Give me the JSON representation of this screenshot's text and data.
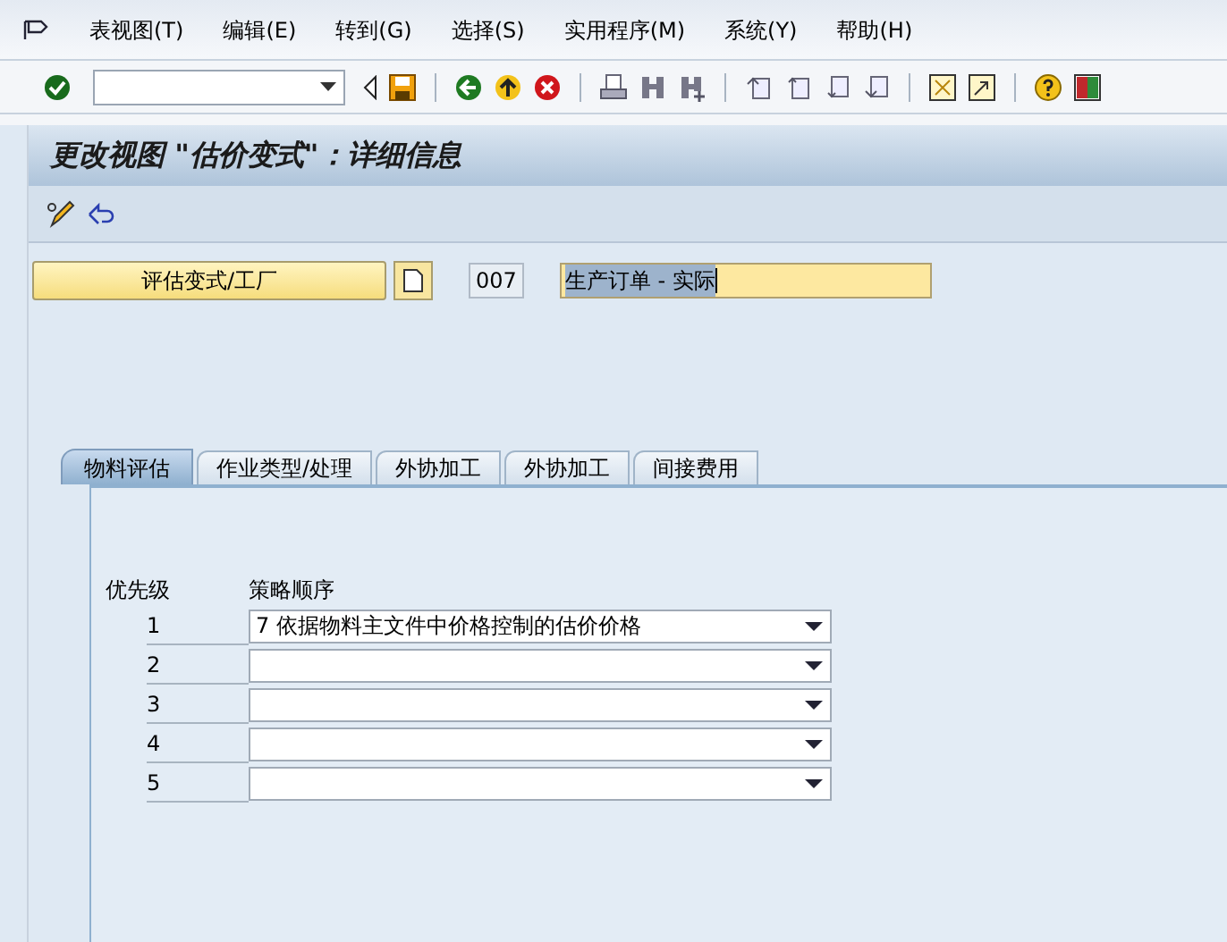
{
  "menu": [
    "表视图(T)",
    "编辑(E)",
    "转到(G)",
    "选择(S)",
    "实用程序(M)",
    "系统(Y)",
    "帮助(H)"
  ],
  "title": "更改视图 \"估价变式\"：详细信息",
  "header": {
    "button": "评估变式/工厂",
    "code": "007",
    "description": "生产订单 - 实际"
  },
  "tabs": [
    {
      "label": "物料评估",
      "selected": true
    },
    {
      "label": "作业类型/处理",
      "selected": false
    },
    {
      "label": "外协加工",
      "selected": false
    },
    {
      "label": "外协加工",
      "selected": false
    },
    {
      "label": "间接费用",
      "selected": false
    }
  ],
  "table": {
    "columns": [
      "优先级",
      "策略顺序"
    ],
    "rows": [
      {
        "priority": "1",
        "value": "7 依据物料主文件中价格控制的估价价格"
      },
      {
        "priority": "2"
      },
      {
        "priority": "3"
      },
      {
        "priority": "4"
      },
      {
        "priority": "5"
      }
    ]
  }
}
